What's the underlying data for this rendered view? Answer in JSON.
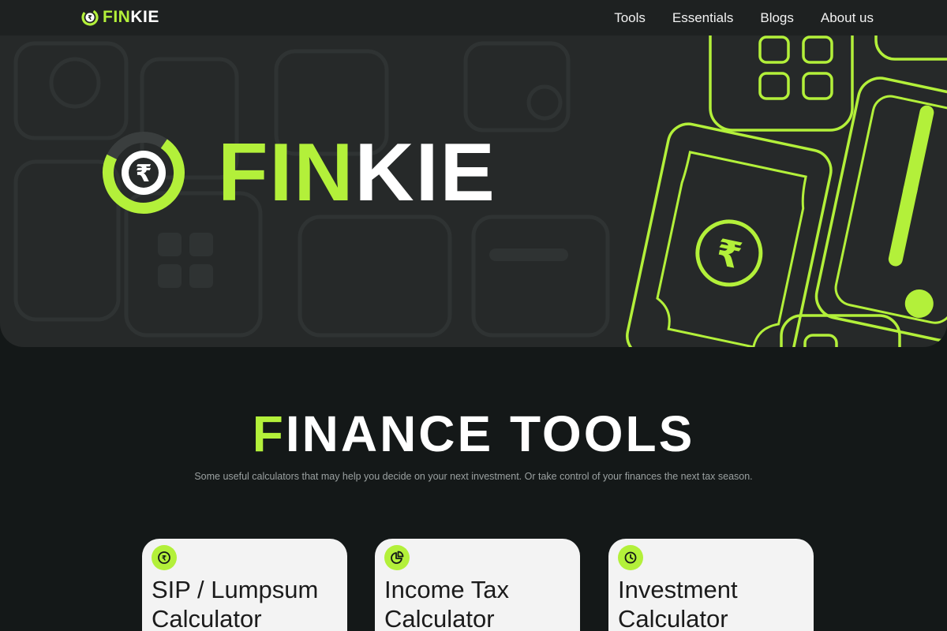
{
  "brand": {
    "name_accent": "FIN",
    "name_rest": "KIE",
    "logo_icon": "rupee-ring-icon"
  },
  "nav": {
    "links": [
      "Tools",
      "Essentials",
      "Blogs",
      "About us"
    ]
  },
  "hero": {
    "name_accent": "FIN",
    "name_rest": "KIE",
    "illustration": "calculator-and-banknote-outline"
  },
  "tools": {
    "title_first_letter": "F",
    "title_rest": "INANCE TOOLS",
    "subtitle": "Some useful calculators that may help you decide on your next investment. Or take control of your finances the next tax season.",
    "cards": [
      {
        "title": "SIP / Lumpsum Calculator",
        "icon": "rupee-icon"
      },
      {
        "title": "Income Tax Calculator",
        "icon": "pie-chart-icon"
      },
      {
        "title": "Investment Calculator",
        "icon": "clock-icon"
      }
    ]
  },
  "colors": {
    "accent": "#b3f03a",
    "background": "#141818",
    "hero_background": "#262929",
    "nav_background": "#1e2121",
    "card_background": "#f3f3f3"
  }
}
